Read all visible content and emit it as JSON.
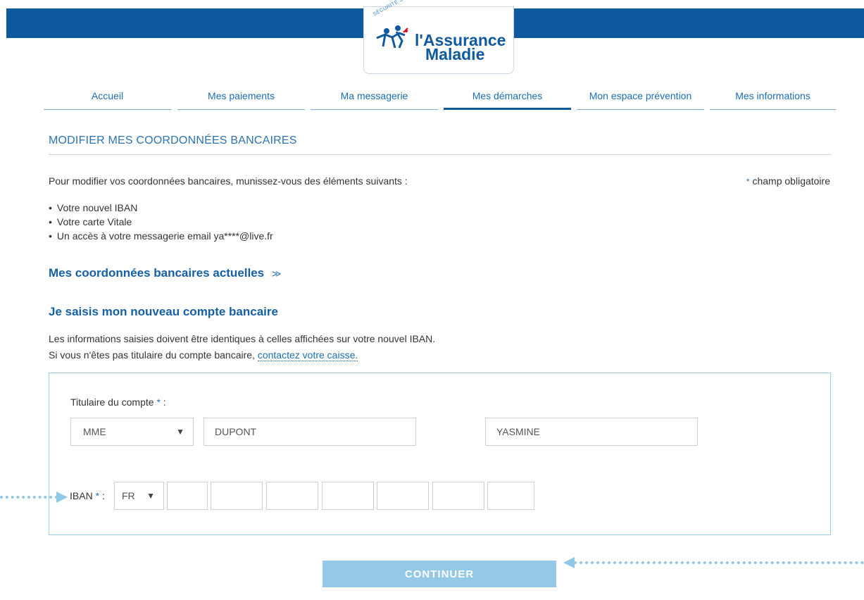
{
  "brand": {
    "seal_text": "SÉCURITÉ SOCIALE",
    "name_line1": "l'Assurance",
    "name_line2": "Maladie",
    "primary_color": "#0f5a9e",
    "accent_color": "#93c9e6"
  },
  "nav": {
    "items": [
      {
        "label": "Accueil"
      },
      {
        "label": "Mes paiements"
      },
      {
        "label": "Ma messagerie"
      },
      {
        "label": "Mes démarches",
        "active": true
      },
      {
        "label": "Mon espace prévention"
      },
      {
        "label": "Mes informations"
      }
    ]
  },
  "page": {
    "title": "MODIFIER MES COORDONNÉES BANCAIRES",
    "intro": "Pour modifier vos coordonnées bancaires, munissez-vous des éléments suivants :",
    "required_star": "*",
    "required_note": "champ obligatoire",
    "bullets": [
      "Votre nouvel IBAN",
      "Votre carte Vitale",
      "Un accès à votre messagerie email ya****@live.fr"
    ],
    "current_accounts_label": "Mes coordonnées bancaires actuelles",
    "current_accounts_chevron": "≫",
    "new_account_heading": "Je saisis mon nouveau compte bancaire",
    "info_line1": "Les informations saisies doivent être identiques à celles affichées sur votre nouvel IBAN.",
    "info_line2_text": "Si vous n'êtes pas titulaire du compte bancaire, ",
    "info_line2_link": "contactez votre caisse."
  },
  "form": {
    "holder_label": "Titulaire du compte",
    "civilite_value": "MME",
    "nom_value": "DUPONT",
    "prenom_value": "YASMINE",
    "iban_label": "IBAN",
    "iban_country_value": "FR",
    "iban_segments": [
      "",
      "",
      "",
      "",
      "",
      "",
      ""
    ],
    "continue_label": "CONTINUER"
  }
}
